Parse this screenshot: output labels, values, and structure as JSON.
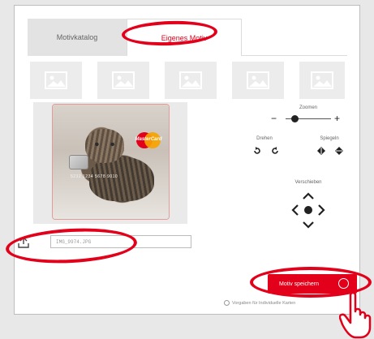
{
  "tabs": [
    {
      "label": "Motivkatalog"
    },
    {
      "label": "Eigenes Motiv"
    }
  ],
  "thumbnails": [
    {
      "icon": "image-icon"
    },
    {
      "icon": "image-icon"
    },
    {
      "icon": "image-icon"
    },
    {
      "icon": "image-icon"
    },
    {
      "icon": "image-icon"
    }
  ],
  "card": {
    "brand": "mastercard",
    "number": "5232 1234 5678 9010"
  },
  "controls": {
    "zoom_label": "Zoomen",
    "zoom_minus": "−",
    "zoom_plus": "+",
    "zoom_level": 0.2,
    "rotate_label": "Drehen",
    "mirror_label": "Spiegeln",
    "move_label": "Verschieben"
  },
  "upload": {
    "filename": "IMG_9974.JPG"
  },
  "save": {
    "label": "Motiv speichern"
  },
  "terms": {
    "label": "Vorgaben für Individuelle Karten"
  },
  "colors": {
    "accent": "#e2001a"
  }
}
